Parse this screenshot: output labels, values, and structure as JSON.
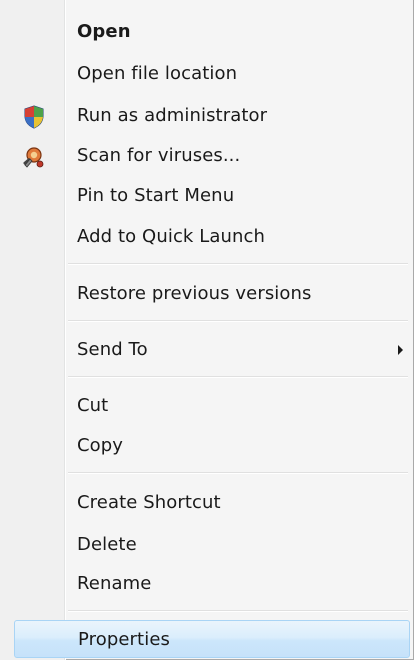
{
  "menu": {
    "items": [
      {
        "label": "Open",
        "bold": true,
        "icon": null
      },
      {
        "label": "Open file location",
        "icon": null
      },
      {
        "label": "Run as administrator",
        "icon": "uac-shield-icon"
      },
      {
        "label": "Scan for viruses...",
        "icon": "antivirus-scan-icon"
      },
      {
        "label": "Pin to Start Menu",
        "icon": null
      },
      {
        "label": "Add to Quick Launch",
        "icon": null
      },
      {
        "label": "Restore previous versions",
        "icon": null
      },
      {
        "label": "Send To",
        "icon": null,
        "submenu": true
      },
      {
        "label": "Cut",
        "icon": null
      },
      {
        "label": "Copy",
        "icon": null
      },
      {
        "label": "Create Shortcut",
        "icon": null
      },
      {
        "label": "Delete",
        "icon": null
      },
      {
        "label": "Rename",
        "icon": null
      },
      {
        "label": "Properties",
        "icon": null,
        "hovered": true
      }
    ]
  },
  "colors": {
    "menu_background": "#f5f5f5",
    "gutter": "#f0f0f0",
    "hover_border": "#a9d4f5",
    "hover_fill": "#cce6fb",
    "text": "#1a1a1a"
  }
}
